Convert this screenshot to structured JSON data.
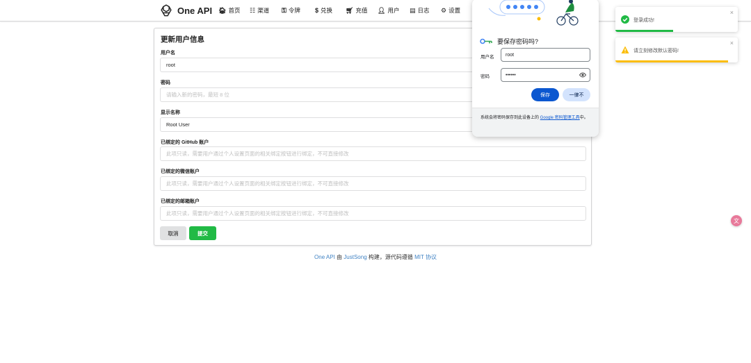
{
  "app": {
    "name": "One API"
  },
  "nav": {
    "items": [
      {
        "icon": "home-icon",
        "glyph": "🏠︎",
        "label": "首页"
      },
      {
        "icon": "sitemap-icon",
        "glyph": "☷",
        "label": "渠道"
      },
      {
        "icon": "key-icon",
        "glyph": "⚿",
        "label": "令牌"
      },
      {
        "icon": "dollar-icon",
        "glyph": "$",
        "label": "兑换"
      },
      {
        "icon": "cart-icon",
        "glyph": "🛒︎",
        "label": "充值"
      },
      {
        "icon": "user-icon",
        "glyph": "👤︎",
        "label": "用户"
      },
      {
        "icon": "book-icon",
        "glyph": "▤",
        "label": "日志"
      },
      {
        "icon": "gear-icon",
        "glyph": "⚙",
        "label": "设置"
      }
    ]
  },
  "form": {
    "title": "更新用户信息",
    "fields": [
      {
        "label": "用户名",
        "value": "root",
        "placeholder": ""
      },
      {
        "label": "密码",
        "value": "",
        "placeholder": "请输入新的密码，最短 8 位"
      },
      {
        "label": "显示名称",
        "value": "Root User",
        "placeholder": ""
      },
      {
        "label": "已绑定的 GitHub 账户",
        "value": "",
        "placeholder": "此项只读，需要用户通过个人设置页面的相关绑定按钮进行绑定，不可直接修改"
      },
      {
        "label": "已绑定的微信账户",
        "value": "",
        "placeholder": "此项只读，需要用户通过个人设置页面的相关绑定按钮进行绑定，不可直接修改"
      },
      {
        "label": "已绑定的邮箱账户",
        "value": "",
        "placeholder": "此项只读，需要用户通过个人设置页面的相关绑定按钮进行绑定，不可直接修改"
      }
    ],
    "cancel_label": "取消",
    "submit_label": "提交"
  },
  "footer": {
    "app_link": "One API",
    "by": "由",
    "author_link": "JustSong",
    "middle": "构建，源代码遵循",
    "license_link": "MIT 协议"
  },
  "password_popup": {
    "title": "要保存密码吗?",
    "username_label": "用户名",
    "username_value": "root",
    "password_label": "密码",
    "password_value": "••••••",
    "save_label": "保存",
    "never_label": "一律不",
    "note_prefix": "系统会将密码保存到此设备上的 ",
    "note_link": "Google 密码管理工具",
    "note_suffix": "中。"
  },
  "toasts": [
    {
      "text": "登录成功!",
      "type": "success",
      "color": "#21ba45"
    },
    {
      "text": "请立刻修改默认密码!",
      "type": "warning",
      "color": "#fbbd08"
    }
  ],
  "colors": {
    "primary": "#21ba45",
    "link": "#4183c4",
    "google_blue": "#0b57d0"
  }
}
